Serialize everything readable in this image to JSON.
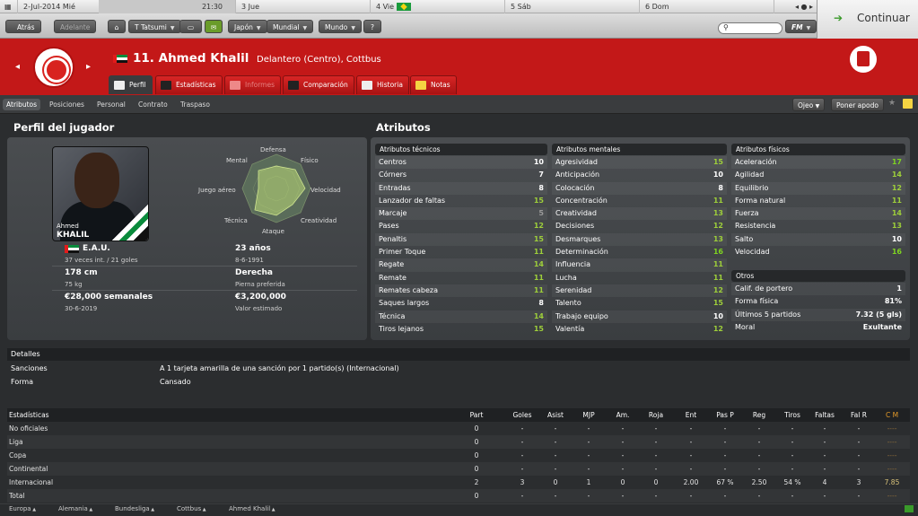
{
  "calendar": {
    "date": "2-Jul-2014",
    "weekday": "Mié",
    "time": "21:30",
    "days": [
      "3 Jue",
      "4 Vie",
      "5 Sáb",
      "6 Dom"
    ]
  },
  "nav": {
    "back": "Atrás",
    "forward": "Adelante",
    "manager": "T Tatsumi",
    "country": "Japón",
    "world_label": "Mundial",
    "world2_label": "Mundo",
    "help": "?",
    "fm_label": "FM",
    "continue_label": "Continuar"
  },
  "player": {
    "number_name": "11. Ahmed Khalil",
    "role_club": "Delantero (Centro), Cottbus",
    "photo_name1": "Ahmed",
    "photo_name2": "KHALIL"
  },
  "tabs": [
    {
      "label": "Perfil"
    },
    {
      "label": "Estadísticas"
    },
    {
      "label": "Informes"
    },
    {
      "label": "Comparación"
    },
    {
      "label": "Historia"
    },
    {
      "label": "Notas"
    }
  ],
  "subtabs": [
    "Atributos",
    "Posiciones",
    "Personal",
    "Contrato",
    "Traspaso"
  ],
  "subnav_buttons": {
    "scout": "Ojeo",
    "support": "Poner apodo"
  },
  "profile": {
    "title": "Perfil del jugador",
    "nationality": "E.A.U.",
    "caps": "37 veces int. / 21 goles",
    "age": "23 años",
    "dob": "8-6-1991",
    "height": "178 cm",
    "weight": "75 kg",
    "foot": "Derecha",
    "foot_label": "Pierna preferida",
    "wage": "€28,000 semanales",
    "contract": "30-6-2019",
    "value": "€3,200,000",
    "value_label": "Valor estimado",
    "spider_labels": [
      "Defensa",
      "Físico",
      "Velocidad",
      "Creatividad",
      "Ataque",
      "Técnica",
      "Juego aéreo",
      "Mental"
    ]
  },
  "attributes_title": "Atributos",
  "technical": {
    "title": "Atributos técnicos",
    "rows": [
      {
        "name": "Centros",
        "value": "10"
      },
      {
        "name": "Córners",
        "value": "7"
      },
      {
        "name": "Entradas",
        "value": "8"
      },
      {
        "name": "Lanzador de faltas",
        "value": "15"
      },
      {
        "name": "Marcaje",
        "value": "5"
      },
      {
        "name": "Pases",
        "value": "12"
      },
      {
        "name": "Penaltis",
        "value": "15"
      },
      {
        "name": "Primer Toque",
        "value": "11"
      },
      {
        "name": "Regate",
        "value": "14"
      },
      {
        "name": "Remate",
        "value": "11"
      },
      {
        "name": "Remates cabeza",
        "value": "11"
      },
      {
        "name": "Saques largos",
        "value": "8"
      },
      {
        "name": "Técnica",
        "value": "14"
      },
      {
        "name": "Tiros lejanos",
        "value": "15"
      }
    ]
  },
  "mental": {
    "title": "Atributos mentales",
    "rows": [
      {
        "name": "Agresividad",
        "value": "15"
      },
      {
        "name": "Anticipación",
        "value": "10"
      },
      {
        "name": "Colocación",
        "value": "8"
      },
      {
        "name": "Concentración",
        "value": "11"
      },
      {
        "name": "Creatividad",
        "value": "13"
      },
      {
        "name": "Decisiones",
        "value": "12"
      },
      {
        "name": "Desmarques",
        "value": "13"
      },
      {
        "name": "Determinación",
        "value": "16"
      },
      {
        "name": "Influencia",
        "value": "11"
      },
      {
        "name": "Lucha",
        "value": "11"
      },
      {
        "name": "Serenidad",
        "value": "12"
      },
      {
        "name": "Talento",
        "value": "15"
      },
      {
        "name": "Trabajo equipo",
        "value": "10"
      },
      {
        "name": "Valentía",
        "value": "12"
      }
    ]
  },
  "physical": {
    "title": "Atributos físicos",
    "rows": [
      {
        "name": "Aceleración",
        "value": "17"
      },
      {
        "name": "Agilidad",
        "value": "14"
      },
      {
        "name": "Equilibrio",
        "value": "12"
      },
      {
        "name": "Forma natural",
        "value": "11"
      },
      {
        "name": "Fuerza",
        "value": "14"
      },
      {
        "name": "Resistencia",
        "value": "13"
      },
      {
        "name": "Salto",
        "value": "10"
      },
      {
        "name": "Velocidad",
        "value": "16"
      }
    ]
  },
  "other": {
    "title": "Otros",
    "rows": [
      {
        "name": "Calif. de portero",
        "value": "1"
      },
      {
        "name": "Forma física",
        "value": "81%"
      },
      {
        "name": "Últimos 5 partidos",
        "value": "7.32 (5 gls)"
      },
      {
        "name": "Moral",
        "value": "Exultante"
      }
    ]
  },
  "details": {
    "title": "Detalles",
    "rows": [
      {
        "label": "Sanciones",
        "value": "A 1 tarjeta amarilla de una sanción por 1 partido(s) (Internacional)"
      },
      {
        "label": "Forma",
        "value": "Cansado"
      }
    ]
  },
  "stats": {
    "title": "Estadísticas",
    "columns": [
      "Part",
      "Goles",
      "Asist",
      "MJP",
      "Am.",
      "Roja",
      "Ent",
      "Pas P",
      "Reg",
      "Tiros",
      "Faltas",
      "Fal R",
      "C M"
    ],
    "rows": [
      {
        "name": "No oficiales",
        "cells": [
          "0",
          "-",
          "-",
          "-",
          "-",
          "-",
          "-",
          "-",
          "-",
          "-",
          "-",
          "-",
          "----"
        ]
      },
      {
        "name": "Liga",
        "cells": [
          "0",
          "-",
          "-",
          "-",
          "-",
          "-",
          "-",
          "-",
          "-",
          "-",
          "-",
          "-",
          "----"
        ]
      },
      {
        "name": "Copa",
        "cells": [
          "0",
          "-",
          "-",
          "-",
          "-",
          "-",
          "-",
          "-",
          "-",
          "-",
          "-",
          "-",
          "----"
        ]
      },
      {
        "name": "Continental",
        "cells": [
          "0",
          "-",
          "-",
          "-",
          "-",
          "-",
          "-",
          "-",
          "-",
          "-",
          "-",
          "-",
          "----"
        ]
      },
      {
        "name": "Internacional",
        "cells": [
          "2",
          "3",
          "0",
          "1",
          "0",
          "0",
          "2.00",
          "67 %",
          "2.50",
          "54 %",
          "4",
          "3",
          "7.85"
        ]
      },
      {
        "name": "Total",
        "cells": [
          "0",
          "-",
          "-",
          "-",
          "-",
          "-",
          "-",
          "-",
          "-",
          "-",
          "-",
          "-",
          "----"
        ]
      }
    ]
  },
  "breadcrumbs": [
    "Europa",
    "Alemania",
    "Bundesliga",
    "Cottbus",
    "Ahmed Khalil"
  ],
  "colors": {
    "accent_red": "#c31818",
    "good_green": "#9ecf3a",
    "great_green": "#7ed321",
    "avg_white": "#ffffff",
    "low_grey": "#9a9a9a",
    "cm_orange": "#e39a2a"
  }
}
